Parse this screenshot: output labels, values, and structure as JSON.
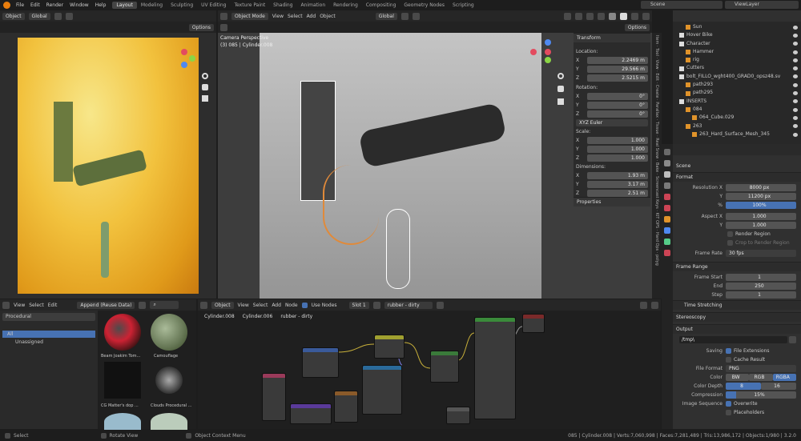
{
  "menu": [
    "File",
    "Edit",
    "Render",
    "Window",
    "Help"
  ],
  "workspaces": [
    "Layout",
    "Modeling",
    "Sculpting",
    "UV Editing",
    "Texture Paint",
    "Shading",
    "Animation",
    "Rendering",
    "Compositing",
    "Geometry Nodes",
    "Scripting"
  ],
  "scene": "Scene",
  "view_layer": "ViewLayer",
  "left_header": {
    "object": "Object",
    "orientation": "Global",
    "options": "Options"
  },
  "viewport": {
    "mode": "Object Mode",
    "view": "View",
    "select": "Select",
    "add": "Add",
    "object": "Object",
    "orientation": "Global",
    "options": "Options",
    "cam_title": "Camera Perspective",
    "cam_sub": "(3) 085 | Cylinder.008"
  },
  "transform": {
    "title": "Transform",
    "location": "Location:",
    "loc": [
      [
        "X",
        "2.2469 m"
      ],
      [
        "Y",
        "29.566 m"
      ],
      [
        "Z",
        "2.5215 m"
      ]
    ],
    "rotation": "Rotation:",
    "rot": [
      [
        "X",
        "0°"
      ],
      [
        "Y",
        "0°"
      ],
      [
        "Z",
        "0°"
      ]
    ],
    "euler": "XYZ Euler",
    "scale": "Scale:",
    "sca": [
      [
        "X",
        "1.000"
      ],
      [
        "Y",
        "1.000"
      ],
      [
        "Z",
        "1.000"
      ]
    ],
    "dimensions": "Dimensions:",
    "dim": [
      [
        "X",
        "1.93 m"
      ],
      [
        "Y",
        "3.17 m"
      ],
      [
        "Z",
        "2.51 m"
      ]
    ],
    "properties": "Properties"
  },
  "outliner": [
    {
      "t": "Sun",
      "i": 1
    },
    {
      "t": "Hover Bike",
      "i": 0
    },
    {
      "t": "Character",
      "i": 0
    },
    {
      "t": "Hammer",
      "i": 1
    },
    {
      "t": "rig",
      "i": 1
    },
    {
      "t": "Cutters",
      "i": 0
    },
    {
      "t": "bolt_FILLO_wght400_GRAD0_opsz48.sv",
      "i": 0
    },
    {
      "t": "path293",
      "i": 1
    },
    {
      "t": "path295",
      "i": 1
    },
    {
      "t": "INSERTS",
      "i": 0
    },
    {
      "t": "084",
      "i": 1
    },
    {
      "t": "064_Cube.029",
      "i": 2
    },
    {
      "t": "263",
      "i": 1
    },
    {
      "t": "263_Hard_Surface_Mesh_345",
      "i": 2
    }
  ],
  "props": {
    "scene": "Scene",
    "format": "Format",
    "res_x_l": "Resolution X",
    "res_x": "8000 px",
    "res_y_l": "Y",
    "res_y": "11200 px",
    "pct_l": "%",
    "pct": "100%",
    "asp_x_l": "Aspect X",
    "asp_x": "1.000",
    "asp_y_l": "Y",
    "asp_y": "1.000",
    "render_region": "Render Region",
    "crop": "Crop to Render Region",
    "fr_l": "Frame Rate",
    "fr": "30 fps",
    "frame_range": "Frame Range",
    "fs_l": "Frame Start",
    "fs": "1",
    "end_l": "End",
    "end": "250",
    "step_l": "Step",
    "step": "1",
    "time_stretch": "Time Stretching",
    "stereo": "Stereoscopy",
    "output": "Output",
    "path": "/tmp\\",
    "saving": "Saving",
    "file_ext": "File Extensions",
    "cache": "Cache Result",
    "ff_l": "File Format",
    "ff": "PNG",
    "color_l": "Color",
    "bw": "BW",
    "rgb": "RGB",
    "rgba": "RGBA",
    "cd_l": "Color Depth",
    "cd8": "8",
    "cd16": "16",
    "comp_l": "Compression",
    "comp": "15%",
    "seq_l": "Image Sequence",
    "overwrite": "Overwrite",
    "placeholders": "Placeholders"
  },
  "vtabs": [
    "Item",
    "Tool",
    "View",
    "Edit",
    "Create",
    "Parallax",
    "Tissue",
    "Real Snow",
    "Bake",
    "Screencast Keys",
    "KIT OPS",
    "Hard Ops",
    "polyg"
  ],
  "asset": {
    "view": "View",
    "select": "Select",
    "edit": "Edit",
    "import": "Append (Reuse Data)",
    "library": "Procedural",
    "cat_all": "All",
    "cat_un": "Unassigned",
    "items": [
      "Beam Joakim Tom...",
      "Camouflage",
      "CG Matter's dop ...",
      "Clouds Procedural ..."
    ]
  },
  "node": {
    "object": "Object",
    "view": "View",
    "select": "Select",
    "add": "Add",
    "node": "Node",
    "use_nodes": "Use Nodes",
    "slot": "Slot 1",
    "material": "rubber - dirty",
    "crumbs": [
      "Cylinder.008",
      "Cylinder.006",
      "rubber - dirty"
    ]
  },
  "status": {
    "select": "Select",
    "rotate": "Rotate View",
    "menu": "Object Context Menu",
    "info": "085 | Cylinder.008 | Verts:7,060,998 | Faces:7,281,489 | Tris:13,986,172 | Objects:1/980 | 3.2.0"
  }
}
